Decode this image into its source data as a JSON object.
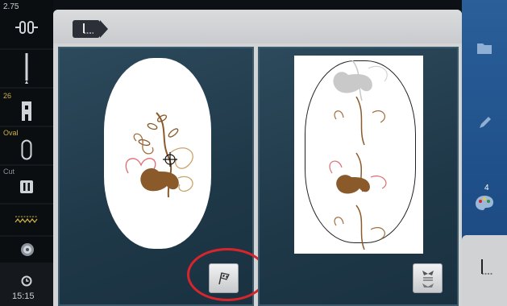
{
  "status_rail": {
    "presser_value": "2.75",
    "presser_foot_number": "26",
    "hoop_label": "Oval",
    "cut_label": "Cut",
    "clock_time": "15:15"
  },
  "icons": {
    "presser_pressure": "presser-pressure-icon",
    "needle": "needle-icon",
    "presser_foot": "presser-foot-icon",
    "hoop": "oval-hoop-icon",
    "cut": "cutter-icon",
    "stitch_pattern": "zigzag-icon",
    "bobbin": "bobbin-icon",
    "clock": "clock-icon",
    "tab": "embroidery-stitch-icon",
    "checkpoint": "checkpoint-flag-icon",
    "embroidery_stack": "embroidery-stack-icon",
    "folder": "folder-icon",
    "pencil": "pencil-icon",
    "palette": "palette-icon",
    "active_tab": "embroidery-stitch-icon"
  },
  "right_rail": {
    "color_count": "4"
  },
  "colors": {
    "accent_blue": "#2a5f9a",
    "highlight_red": "#d6262c",
    "amber_text": "#c9b14a",
    "pane_teal": "#1f3848"
  }
}
